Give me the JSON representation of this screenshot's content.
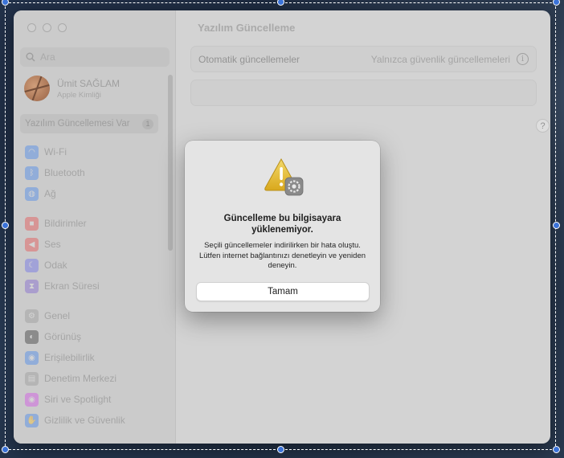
{
  "sidebar": {
    "search_placeholder": "Ara",
    "account": {
      "name": "Ümit SAĞLAM",
      "subtitle": "Apple Kimliği"
    },
    "update_item": {
      "label": "Yazılım Güncellemesi Var",
      "badge": "1"
    },
    "groups": [
      [
        {
          "label": "Wi-Fi",
          "icon": "wifi-icon",
          "color": "#3b82f6",
          "glyph": "◠"
        },
        {
          "label": "Bluetooth",
          "icon": "bluetooth-icon",
          "color": "#3b82f6",
          "glyph": "ᛒ"
        },
        {
          "label": "Ağ",
          "icon": "network-icon",
          "color": "#3b82f6",
          "glyph": "◍"
        }
      ],
      [
        {
          "label": "Bildirimler",
          "icon": "notifications-icon",
          "color": "#ef4444",
          "glyph": "■"
        },
        {
          "label": "Ses",
          "icon": "sound-icon",
          "color": "#ef4444",
          "glyph": "◀"
        },
        {
          "label": "Odak",
          "icon": "focus-icon",
          "color": "#6366f1",
          "glyph": "☾"
        },
        {
          "label": "Ekran Süresi",
          "icon": "screen-time-icon",
          "color": "#7c5cd6",
          "glyph": "⧗"
        }
      ],
      [
        {
          "label": "Genel",
          "icon": "general-icon",
          "color": "#9a9a9a",
          "glyph": "⚙"
        },
        {
          "label": "Görünüş",
          "icon": "appearance-icon",
          "color": "#2b2b2b",
          "glyph": "◐"
        },
        {
          "label": "Erişilebilirlik",
          "icon": "accessibility-icon",
          "color": "#3b82f6",
          "glyph": "◉"
        },
        {
          "label": "Denetim Merkezi",
          "icon": "control-center-icon",
          "color": "#9a9a9a",
          "glyph": "▤"
        },
        {
          "label": "Siri ve Spotlight",
          "icon": "siri-icon",
          "color": "#d946ef",
          "glyph": "◉"
        },
        {
          "label": "Gizlilik ve Güvenlik",
          "icon": "privacy-icon",
          "color": "#3b82f6",
          "glyph": "✋"
        }
      ]
    ]
  },
  "main": {
    "title": "Yazılım Güncelleme",
    "auto_updates_label": "Otomatik güncellemeler",
    "auto_updates_value": "Yalnızca güvenlik güncellemeleri",
    "help": "?"
  },
  "dialog": {
    "title": "Güncelleme bu bilgisayara yüklenemiyor.",
    "message": "Seçili güncellemeler indirilirken bir hata oluştu. Lütfen internet bağlantınızı denetleyin ve yeniden deneyin.",
    "ok_label": "Tamam"
  }
}
